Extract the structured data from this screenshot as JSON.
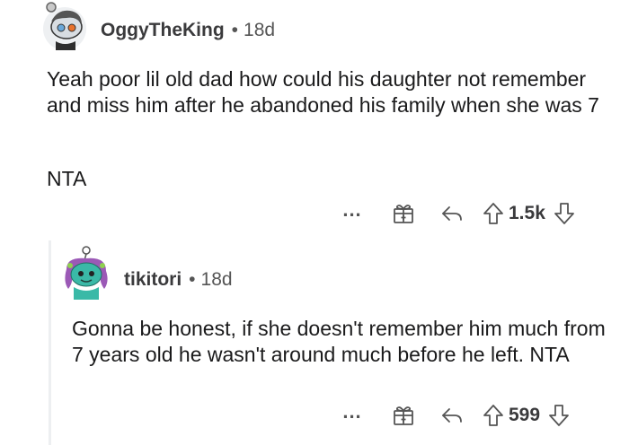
{
  "comments": [
    {
      "username": "OggyTheKing",
      "separator": "•",
      "age": "18d",
      "body": "Yeah poor lil old dad how could his daughter not remember and miss him after he abandoned his family when she was 7",
      "verdict": "NTA",
      "more_label": "...",
      "score": "1.5k",
      "icons": [
        "more-icon",
        "gift-icon",
        "reply-icon",
        "upvote-icon",
        "downvote-icon"
      ]
    },
    {
      "username": "tikitori",
      "separator": "•",
      "age": "18d",
      "body": "Gonna be honest, if she doesn't remember him much from 7 years old he wasn't around much before he left. NTA",
      "more_label": "...",
      "score": "599",
      "icons": [
        "more-icon",
        "gift-icon",
        "reply-icon",
        "upvote-icon",
        "downvote-icon"
      ]
    }
  ],
  "colors": {
    "text": "#1a1a1b",
    "meta": "#555555",
    "thread_line": "#edeff1",
    "avatar2_skin": "#3ab9a7",
    "avatar2_hair": "#9b59b6"
  }
}
